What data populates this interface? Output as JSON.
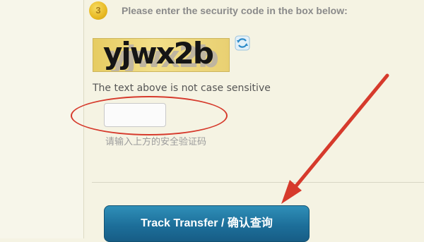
{
  "step": {
    "number": "3",
    "instruction": "Please enter the security code in the box below:"
  },
  "captcha": {
    "text": "yjwx2b",
    "refresh_icon": "refresh-icon"
  },
  "case_note": "The text above is not case sensitive",
  "code_input": {
    "value": "",
    "placeholder": ""
  },
  "hint_cn": "请输入上方的安全验证码",
  "button": {
    "label": "Track Transfer / 确认查询"
  },
  "colors": {
    "background": "#f5f3e3",
    "accent_button": "#1d6f9a",
    "annotation_red": "#d63a2c",
    "badge_gold": "#e8b923"
  }
}
